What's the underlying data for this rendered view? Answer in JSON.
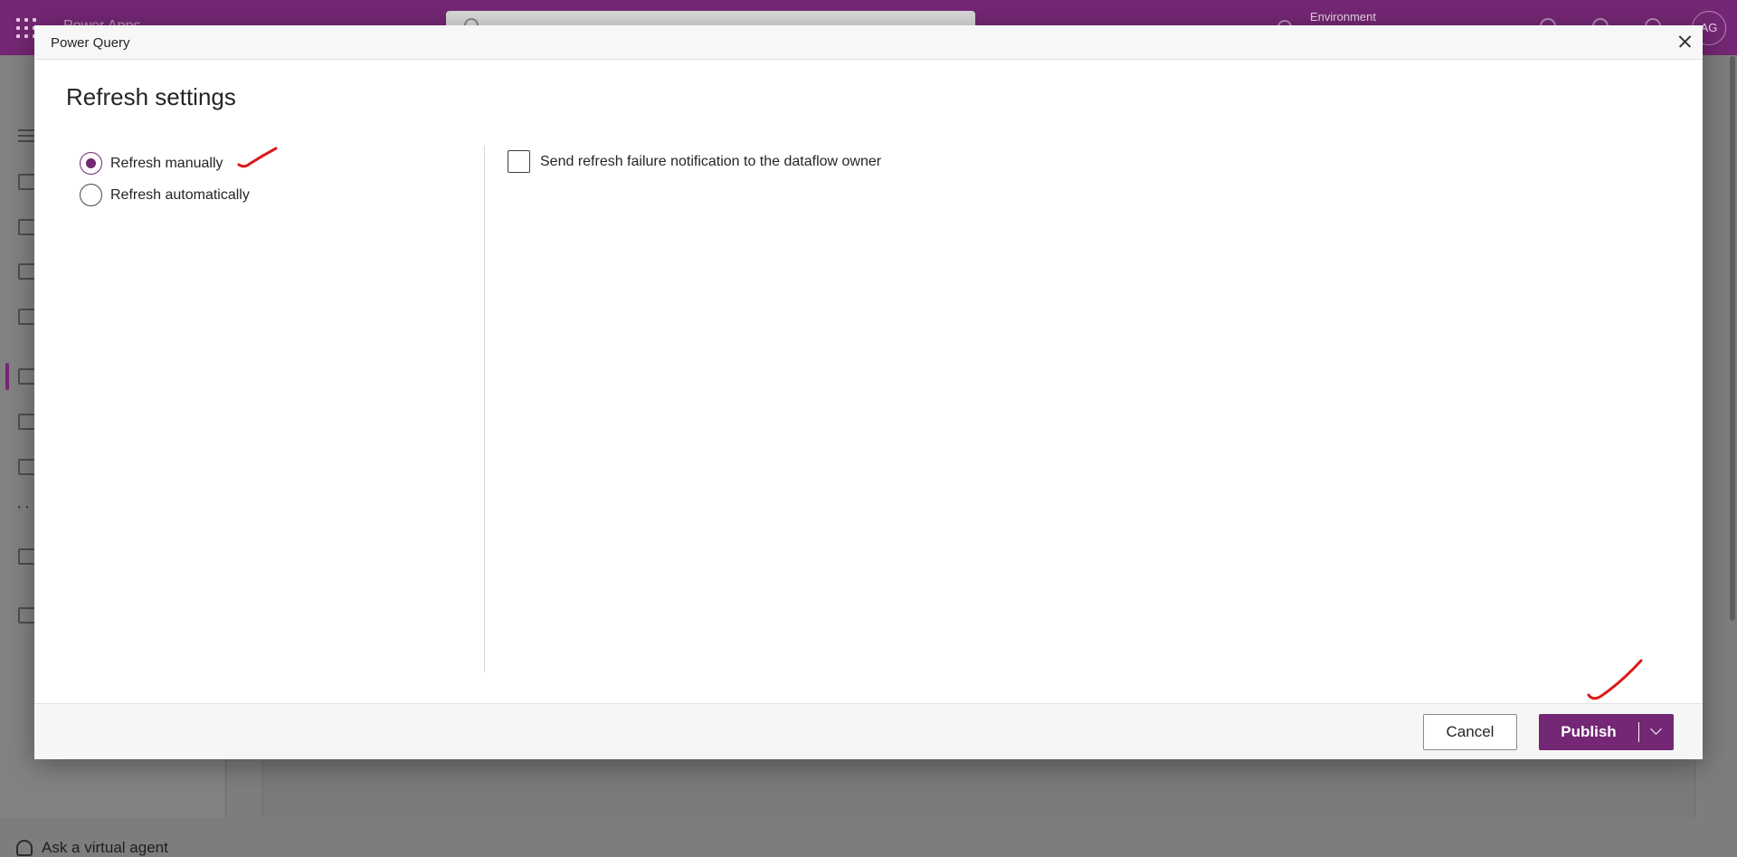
{
  "app": {
    "name": "Power Apps",
    "environment_label": "Environment",
    "avatar_initials": "AG",
    "brand_color": "#742774"
  },
  "nav": {
    "virtual_agent_label": "Ask a virtual agent",
    "more_label": "···"
  },
  "dialog": {
    "title": "Power Query",
    "heading": "Refresh settings",
    "options": [
      {
        "label": "Refresh manually",
        "selected": true
      },
      {
        "label": "Refresh automatically",
        "selected": false
      }
    ],
    "notification_checkbox": {
      "label": "Send refresh failure notification to the dataflow owner",
      "checked": false
    },
    "footer": {
      "cancel_label": "Cancel",
      "publish_label": "Publish"
    }
  },
  "icons": {
    "close": "close-icon",
    "chevron": "chevron-down-icon",
    "waffle": "app-launcher-icon",
    "search": "search-icon"
  }
}
